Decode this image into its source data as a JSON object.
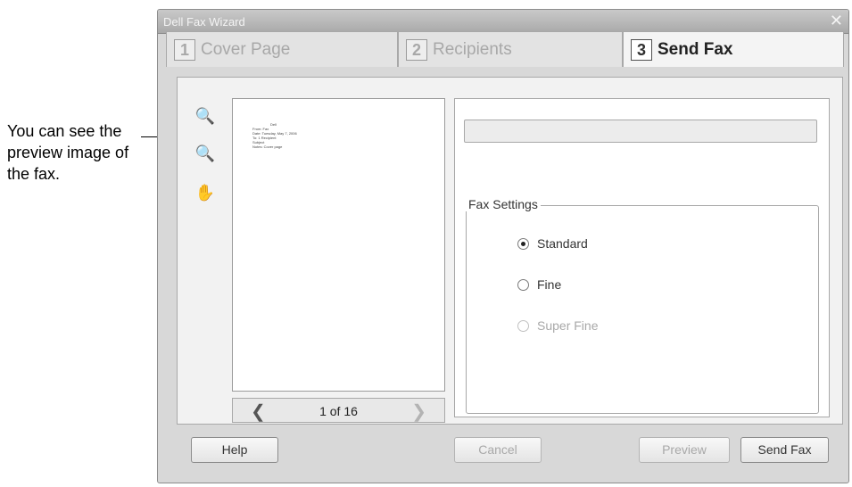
{
  "callout": {
    "text": "You can see the preview image of the fax."
  },
  "window": {
    "title": "Dell Fax Wizard",
    "close_glyph": "✕"
  },
  "tabs": [
    {
      "number": "1",
      "label": "Cover Page",
      "active": false
    },
    {
      "number": "2",
      "label": "Recipients",
      "active": false
    },
    {
      "number": "3",
      "label": "Send Fax",
      "active": true
    }
  ],
  "tools": {
    "zoom_out": "🔍",
    "zoom_in": "🔍",
    "pan": "✋"
  },
  "preview": {
    "thumbnail_lines": [
      "Dell",
      "From: Fax",
      "Date: Tuesday, May 7, 2006",
      "To:  1 Recipient",
      "Subject",
      "Notes: Cover page"
    ],
    "prev_glyph": "❮",
    "next_glyph": "❯",
    "page_counter": "1 of 16"
  },
  "fax_settings": {
    "legend": "Fax Settings",
    "options": [
      {
        "label": "Standard",
        "selected": true,
        "enabled": true
      },
      {
        "label": "Fine",
        "selected": false,
        "enabled": true
      },
      {
        "label": "Super Fine",
        "selected": false,
        "enabled": false
      }
    ]
  },
  "buttons": {
    "help": "Help",
    "cancel": "Cancel",
    "preview": "Preview",
    "send_fax": "Send Fax"
  }
}
